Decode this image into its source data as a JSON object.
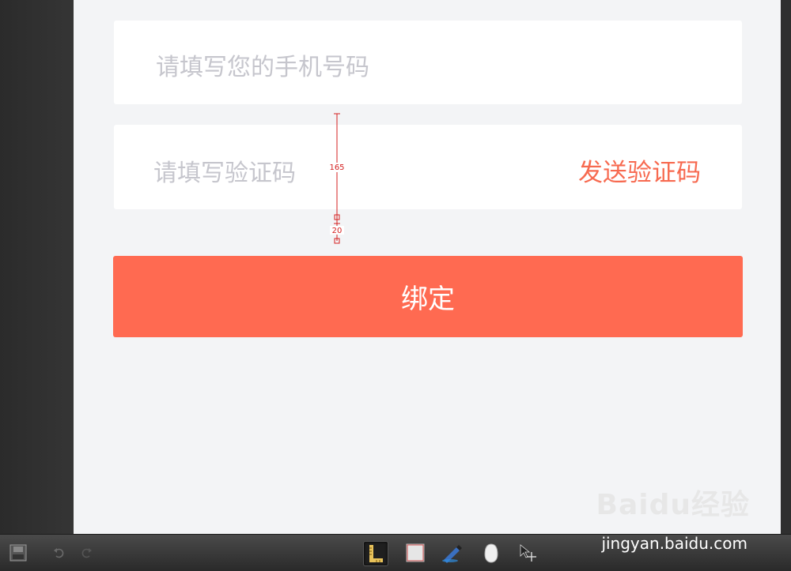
{
  "form": {
    "phone_placeholder": "请填写您的手机号码",
    "code_placeholder": "请填写验证码",
    "send_code_label": "发送验证码",
    "bind_label": "绑定"
  },
  "measurement": {
    "label_large": "165",
    "label_small": "20"
  },
  "toolbar": {
    "tools": [
      "save-icon",
      "undo-icon",
      "redo-icon",
      "ruler-icon",
      "rectangle-icon",
      "pen-icon",
      "shape-icon",
      "move-icon"
    ]
  },
  "watermark": {
    "logo": "Baidu经验",
    "url": "jingyan.baidu.com"
  },
  "colors": {
    "accent": "#ff6a51",
    "send_code": "#f76a50",
    "placeholder": "#c6c6cd",
    "canvas": "#f3f4f6",
    "measure_line": "#d42020"
  }
}
